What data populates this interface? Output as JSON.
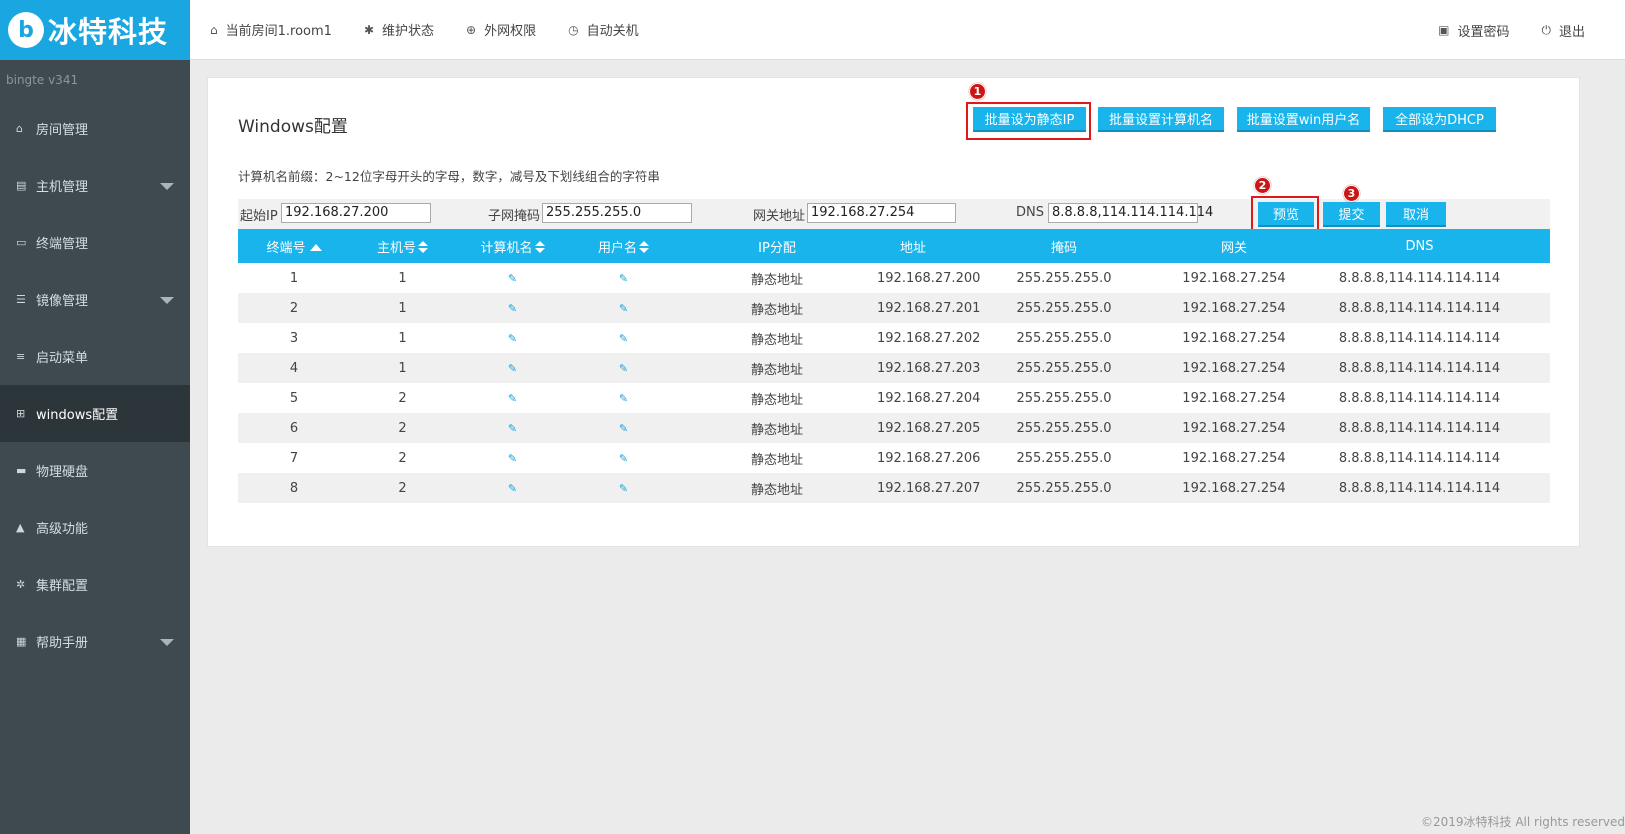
{
  "brand": {
    "logo_mark": "b",
    "name": "冰特科技",
    "version": "bingte  v341"
  },
  "topnav": [
    {
      "icon": "home-icon",
      "glyph": "⌂",
      "label": "当前房间1.room1"
    },
    {
      "icon": "wrench-icon",
      "glyph": "✱",
      "label": "维护状态"
    },
    {
      "icon": "globe-icon",
      "glyph": "⊕",
      "label": "外网权限"
    },
    {
      "icon": "clock-icon",
      "glyph": "◷",
      "label": "自动关机"
    }
  ],
  "topright": [
    {
      "icon": "lock-icon",
      "glyph": "▣",
      "label": "设置密码"
    },
    {
      "icon": "power-icon",
      "glyph": "⏻",
      "label": "退出"
    }
  ],
  "sidebar": {
    "items": [
      {
        "icon": "home-icon",
        "glyph": "⌂",
        "label": "房间管理",
        "caret": false
      },
      {
        "icon": "server-icon",
        "glyph": "▤",
        "label": "主机管理",
        "caret": true
      },
      {
        "icon": "monitor-icon",
        "glyph": "▭",
        "label": "终端管理",
        "caret": false
      },
      {
        "icon": "database-icon",
        "glyph": "☰",
        "label": "镜像管理",
        "caret": true
      },
      {
        "icon": "list-icon",
        "glyph": "≡",
        "label": "启动菜单",
        "caret": false
      },
      {
        "icon": "windows-icon",
        "glyph": "⊞",
        "label": "windows配置",
        "caret": false,
        "active": true
      },
      {
        "icon": "hdd-icon",
        "glyph": "▬",
        "label": "物理硬盘",
        "caret": false
      },
      {
        "icon": "warning-icon",
        "glyph": "▲",
        "label": "高级功能",
        "caret": false
      },
      {
        "icon": "gear-icon",
        "glyph": "✲",
        "label": "集群配置",
        "caret": false
      },
      {
        "icon": "book-icon",
        "glyph": "▦",
        "label": "帮助手册",
        "caret": true
      }
    ]
  },
  "main": {
    "title": "Windows配置",
    "buttons": {
      "static_ip": "批量设为静态IP",
      "computer_name": "批量设置计算机名",
      "win_user": "批量设置win用户名",
      "dhcp": "全部设为DHCP",
      "preview": "预览",
      "submit": "提交",
      "cancel": "取消"
    },
    "badges": [
      "1",
      "2",
      "3"
    ],
    "hint": "计算机名前缀：2~12位字母开头的字母，数字，减号及下划线组合的字符串",
    "form": {
      "start_ip_label": "起始IP",
      "start_ip": "192.168.27.200",
      "mask_label": "子网掩码",
      "mask": "255.255.255.0",
      "gateway_label": "网关地址",
      "gateway": "192.168.27.254",
      "dns_label": "DNS",
      "dns": "8.8.8.8,114.114.114.114"
    },
    "table": {
      "headers": [
        "终端号",
        "主机号",
        "计算机名",
        "用户名",
        "IP分配",
        "地址",
        "掩码",
        "网关",
        "DNS"
      ],
      "edit_glyph": "✎",
      "rows": [
        [
          "1",
          "1",
          "静态地址",
          "192.168.27.200",
          "255.255.255.0",
          "192.168.27.254",
          "8.8.8.8,114.114.114.114"
        ],
        [
          "2",
          "1",
          "静态地址",
          "192.168.27.201",
          "255.255.255.0",
          "192.168.27.254",
          "8.8.8.8,114.114.114.114"
        ],
        [
          "3",
          "1",
          "静态地址",
          "192.168.27.202",
          "255.255.255.0",
          "192.168.27.254",
          "8.8.8.8,114.114.114.114"
        ],
        [
          "4",
          "1",
          "静态地址",
          "192.168.27.203",
          "255.255.255.0",
          "192.168.27.254",
          "8.8.8.8,114.114.114.114"
        ],
        [
          "5",
          "2",
          "静态地址",
          "192.168.27.204",
          "255.255.255.0",
          "192.168.27.254",
          "8.8.8.8,114.114.114.114"
        ],
        [
          "6",
          "2",
          "静态地址",
          "192.168.27.205",
          "255.255.255.0",
          "192.168.27.254",
          "8.8.8.8,114.114.114.114"
        ],
        [
          "7",
          "2",
          "静态地址",
          "192.168.27.206",
          "255.255.255.0",
          "192.168.27.254",
          "8.8.8.8,114.114.114.114"
        ],
        [
          "8",
          "2",
          "静态地址",
          "192.168.27.207",
          "255.255.255.0",
          "192.168.27.254",
          "8.8.8.8,114.114.114.114"
        ]
      ]
    }
  },
  "footer": "©2019冰特科技 All rights reserved",
  "colors": {
    "accent": "#19b4ec",
    "sidebar": "#3e4a50",
    "highlight": "#e01818"
  }
}
